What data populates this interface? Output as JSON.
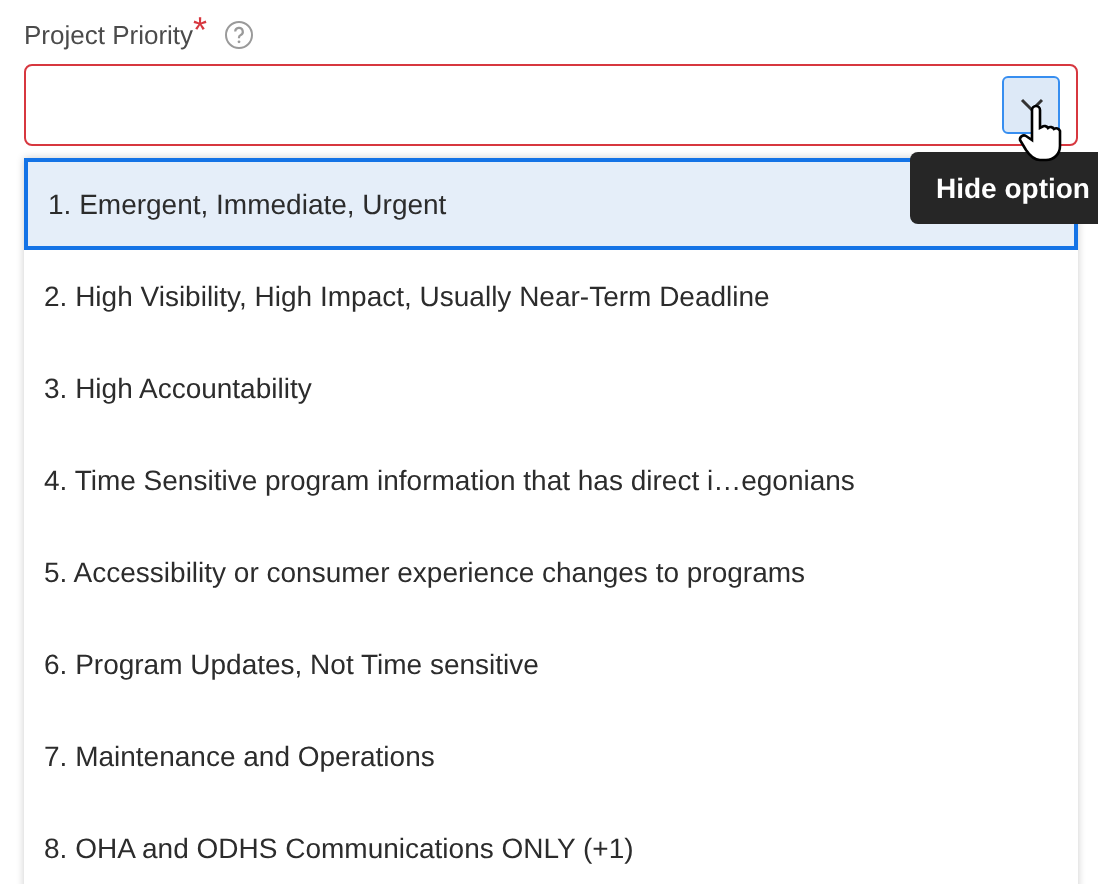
{
  "field": {
    "label": "Project Priority",
    "required_mark": "*",
    "invalid": true,
    "expanded": true
  },
  "options": [
    {
      "label": "1. Emergent, Immediate, Urgent",
      "selected": true
    },
    {
      "label": "2. High Visibility, High Impact, Usually Near-Term Deadline",
      "selected": false
    },
    {
      "label": "3. High Accountability",
      "selected": false
    },
    {
      "label": "4. Time Sensitive program information that has direct i…egonians",
      "selected": false
    },
    {
      "label": "5. Accessibility or consumer experience changes to programs",
      "selected": false
    },
    {
      "label": "6. Program Updates, Not Time sensitive",
      "selected": false
    },
    {
      "label": "7. Maintenance and Operations",
      "selected": false
    },
    {
      "label": "8. OHA and ODHS Communications ONLY (+1)",
      "selected": false
    }
  ],
  "tooltip": "Hide option"
}
